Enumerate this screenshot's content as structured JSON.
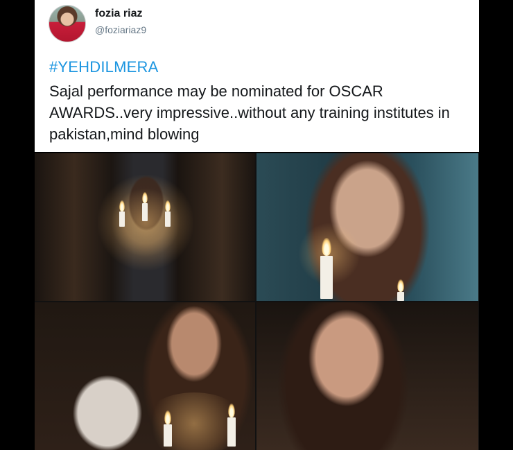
{
  "tweet": {
    "display_name": "fozia riaz",
    "handle": "@foziariaz9",
    "hashtag": "#YEHDILMERA",
    "text": "Sajal performance may be nominated for OSCAR AWARDS..very impressive..without any training institutes in pakistan,mind blowing"
  },
  "photos": [
    {
      "name": "photo-hallway-candelabra"
    },
    {
      "name": "photo-closeup-candle"
    },
    {
      "name": "photo-doll-candles"
    },
    {
      "name": "photo-closeup-dark"
    }
  ],
  "colors": {
    "hashtag": "#1b95e0",
    "text": "#14171a",
    "handle": "#657786",
    "card_bg": "#ffffff",
    "page_bg": "#000000"
  }
}
